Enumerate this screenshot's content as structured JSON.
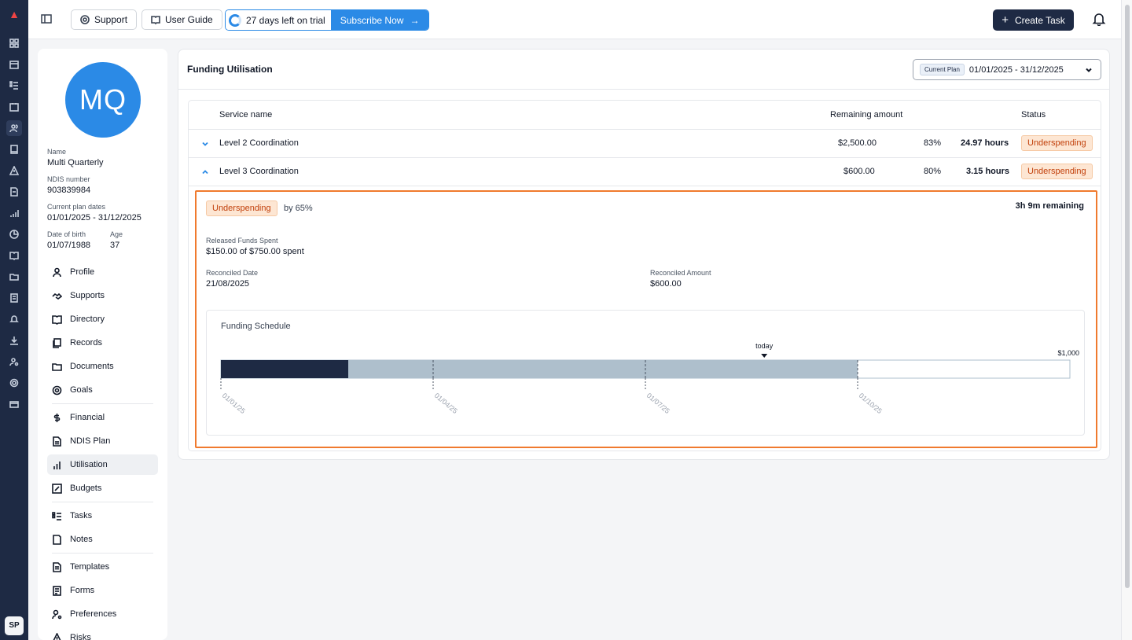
{
  "topbar": {
    "support_label": "Support",
    "user_guide_label": "User Guide",
    "trial_text": "27 days left on trial",
    "subscribe_label": "Subscribe Now",
    "create_task_label": "Create Task"
  },
  "rail": {
    "avatar_initials": "SP"
  },
  "profile": {
    "initials": "MQ",
    "name_label": "Name",
    "name": "Multi Quarterly",
    "ndis_label": "NDIS number",
    "ndis_number": "903839984",
    "plan_dates_label": "Current plan dates",
    "plan_dates": "01/01/2025 - 31/12/2025",
    "dob_label": "Date of birth",
    "dob": "01/07/1988",
    "age_label": "Age",
    "age": "37",
    "menu": [
      {
        "label": "Profile",
        "icon": "user-icon"
      },
      {
        "label": "Supports",
        "icon": "handshake-icon"
      },
      {
        "label": "Directory",
        "icon": "book-open-icon"
      },
      {
        "label": "Records",
        "icon": "records-icon"
      },
      {
        "label": "Documents",
        "icon": "folder-icon"
      },
      {
        "label": "Goals",
        "icon": "goal-icon"
      },
      {
        "label": "Financial",
        "icon": "dollar-icon"
      },
      {
        "label": "NDIS Plan",
        "icon": "file-icon"
      },
      {
        "label": "Utilisation",
        "icon": "bar-chart-icon"
      },
      {
        "label": "Budgets",
        "icon": "percent-icon"
      },
      {
        "label": "Tasks",
        "icon": "list-checks-icon"
      },
      {
        "label": "Notes",
        "icon": "note-icon"
      },
      {
        "label": "Templates",
        "icon": "template-icon"
      },
      {
        "label": "Forms",
        "icon": "form-icon"
      },
      {
        "label": "Preferences",
        "icon": "user-cog-icon"
      },
      {
        "label": "Risks",
        "icon": "warning-icon"
      }
    ]
  },
  "main": {
    "title": "Funding Utilisation",
    "plan_tag": "Current Plan",
    "plan_range": "01/01/2025 - 31/12/2025",
    "columns": {
      "service": "Service name",
      "remaining": "Remaining amount",
      "status": "Status"
    },
    "rows": [
      {
        "service": "Level 2 Coordination",
        "amount": "$2,500.00",
        "percent": "83%",
        "hours": "24.97 hours",
        "status": "Underspending"
      },
      {
        "service": "Level 3 Coordination",
        "amount": "$600.00",
        "percent": "80%",
        "hours": "3.15 hours",
        "status": "Underspending"
      }
    ],
    "detail": {
      "status_badge": "Underspending",
      "by_text": "by 65%",
      "remaining_text": "3h 9m remaining",
      "released_label": "Released Funds Spent",
      "released_value": "$150.00 of $750.00 spent",
      "reconciled_date_label": "Reconciled Date",
      "reconciled_date": "21/08/2025",
      "reconciled_amount_label": "Reconciled Amount",
      "reconciled_amount": "$600.00",
      "schedule_title": "Funding Schedule"
    }
  },
  "chart_data": {
    "type": "bar",
    "title": "Funding Schedule",
    "x_ticks": [
      "01/01/25",
      "01/04/25",
      "01/07/25",
      "01/10/25"
    ],
    "today_label": "today",
    "today_fraction": 0.64,
    "max_label": "$1,000",
    "spent_fraction": 0.15,
    "released_fraction": 0.75,
    "colors": {
      "spent": "#1e2a44",
      "released": "#aebfcc",
      "unreleased": "#ffffff",
      "border": "#aebfcc"
    }
  }
}
